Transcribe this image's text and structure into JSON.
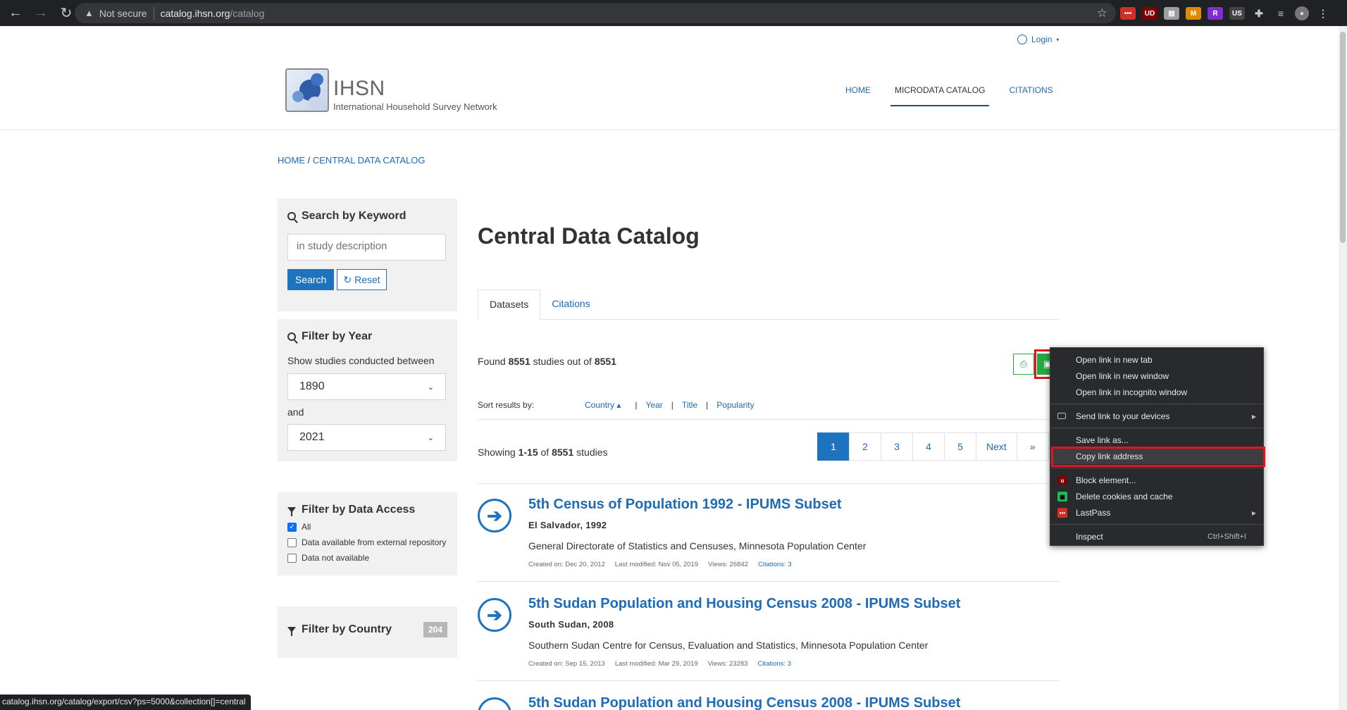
{
  "browser": {
    "security_label": "Not secure",
    "url_host": "catalog.ihsn.org",
    "url_path": "/catalog",
    "status_url": "catalog.ihsn.org/catalog/export/csv?ps=5000&collection[]=central",
    "extensions": [
      {
        "name": "lastpass-extension",
        "text": "•••",
        "color": "#d32d27"
      },
      {
        "name": "ublock-extension",
        "text": "UD",
        "color": "#800000"
      },
      {
        "name": "grid-extension",
        "text": "▤",
        "color": "#9e9e9e"
      },
      {
        "name": "orange-extension",
        "text": "M",
        "color": "#e08a00"
      },
      {
        "name": "r-extension",
        "text": "R",
        "color": "#7b2fd1"
      },
      {
        "name": "us-extension",
        "text": "US",
        "color": "#444444"
      },
      {
        "name": "puzzle-icon",
        "text": "✚",
        "color": "#202124"
      },
      {
        "name": "reading-list-icon",
        "text": "≡",
        "color": "#202124"
      },
      {
        "name": "profile-avatar",
        "text": "●",
        "color": "#777777"
      },
      {
        "name": "kebab-menu-icon",
        "text": "⋮",
        "color": "#202124"
      }
    ]
  },
  "header": {
    "login_label": "Login",
    "logo_title": "IHSN",
    "logo_subtitle": "International Household Survey Network",
    "nav": [
      {
        "label": "HOME",
        "active": false
      },
      {
        "label": "MICRODATA CATALOG",
        "active": true
      },
      {
        "label": "CITATIONS",
        "active": false
      }
    ]
  },
  "breadcrumb": {
    "home": "HOME",
    "separator": "/",
    "current": "CENTRAL DATA CATALOG"
  },
  "sidebar": {
    "keyword": {
      "title": "Search by Keyword",
      "placeholder": "in study description",
      "search_label": "Search",
      "reset_label": "Reset"
    },
    "year": {
      "title": "Filter by Year",
      "description": "Show studies conducted between",
      "from": "1890",
      "and_label": "and",
      "to": "2021"
    },
    "access": {
      "title": "Filter by Data Access",
      "options": [
        {
          "label": "All",
          "checked": true
        },
        {
          "label": "Data available from external repository",
          "checked": false
        },
        {
          "label": "Data not available",
          "checked": false
        }
      ]
    },
    "country": {
      "title": "Filter by Country",
      "count": "204"
    }
  },
  "main": {
    "title": "Central Data Catalog",
    "tabs": [
      {
        "label": "Datasets",
        "active": true
      },
      {
        "label": "Citations",
        "active": false
      }
    ],
    "found": {
      "prefix": "Found",
      "count": "8551",
      "middle": "studies out of",
      "total": "8551"
    },
    "sort": {
      "label": "Sort results by:",
      "options": [
        "Country",
        "Year",
        "Title",
        "Popularity"
      ],
      "active_indicator": "▴"
    },
    "showing": {
      "prefix": "Showing",
      "range": "1-15",
      "of": "of",
      "total": "8551",
      "suffix": "studies"
    },
    "pagination": [
      "1",
      "2",
      "3",
      "4",
      "5",
      "Next",
      "»"
    ],
    "studies": [
      {
        "title": "5th Census of Population 1992 - IPUMS Subset",
        "country_year": "El Salvador, 1992",
        "org": "General Directorate of Statistics and Censuses, Minnesota Population Center",
        "created": "Created on: Dec 20, 2012",
        "modified": "Last modified: Nov 05, 2019",
        "views": "Views: 26842",
        "citations": "Citations: 3"
      },
      {
        "title": "5th Sudan Population and Housing Census 2008 - IPUMS Subset",
        "country_year": "South Sudan, 2008",
        "org": "Southern Sudan Centre for Census, Evaluation and Statistics, Minnesota Population Center",
        "created": "Created on: Sep 15, 2013",
        "modified": "Last modified: Mar 29, 2019",
        "views": "Views: 23283",
        "citations": "Citations: 3"
      },
      {
        "title": "5th Sudan Population and Housing Census 2008 - IPUMS Subset",
        "country_year": "",
        "org": "",
        "created": "",
        "modified": "",
        "views": "",
        "citations": ""
      }
    ]
  },
  "context_menu": {
    "items": [
      {
        "label": "Open link in new tab"
      },
      {
        "label": "Open link in new window"
      },
      {
        "label": "Open link in incognito window"
      },
      {
        "label": "Send link to your devices"
      },
      {
        "label": "Save link as..."
      },
      {
        "label": "Copy link address"
      },
      {
        "label": "Block element..."
      },
      {
        "label": "Delete cookies and cache"
      },
      {
        "label": "LastPass"
      },
      {
        "label": "Inspect",
        "shortcut": "Ctrl+Shift+I"
      }
    ]
  },
  "colors": {
    "link": "#1e6bb8",
    "primary": "#1e73be",
    "export_green": "#28a745",
    "highlight_red": "#e0141e",
    "menu_bg": "#292a2d"
  }
}
